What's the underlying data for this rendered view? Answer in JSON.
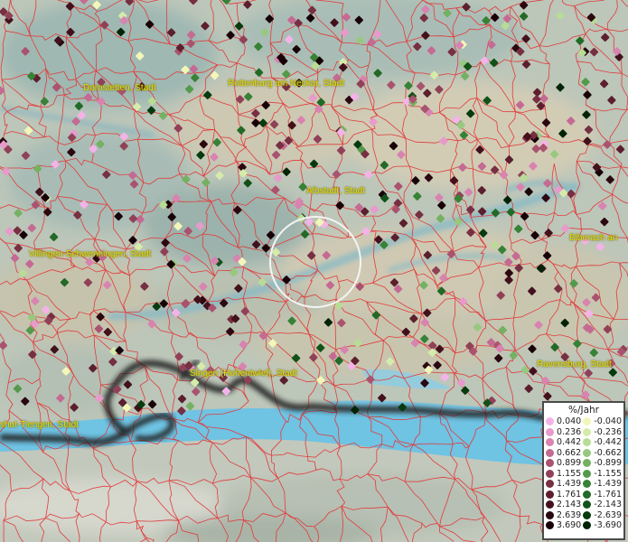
{
  "places": [
    {
      "id": "dornstetten",
      "label": "Dornstetten, Stadt"
    },
    {
      "id": "rottenburg",
      "label": "Rottenburg am Neckar, Stadt"
    },
    {
      "id": "albstadt",
      "label": "Albstadt, Stadt"
    },
    {
      "id": "biberach",
      "label": "Biberach an"
    },
    {
      "id": "villingen",
      "label": "Villingen-Schwenningen, Stadt"
    },
    {
      "id": "singen",
      "label": "Singen (Hohentwiel), Stadt"
    },
    {
      "id": "ravensburg",
      "label": "Ravensburg, Stadt"
    },
    {
      "id": "waldshut",
      "label": "shut-Tiengen, Stadt"
    }
  ],
  "legend": {
    "title": "%/Jahr",
    "positive": [
      {
        "label": "0.040",
        "color": "#f4b3e8"
      },
      {
        "label": "0.236",
        "color": "#e79acb"
      },
      {
        "label": "0.442",
        "color": "#d883b0"
      },
      {
        "label": "0.662",
        "color": "#c46a93"
      },
      {
        "label": "0.899",
        "color": "#a9536f"
      },
      {
        "label": "1.155",
        "color": "#904157"
      },
      {
        "label": "1.439",
        "color": "#772f42"
      },
      {
        "label": "1.761",
        "color": "#5c1f2d"
      },
      {
        "label": "2.143",
        "color": "#42111c"
      },
      {
        "label": "2.639",
        "color": "#2b0710"
      },
      {
        "label": "3.690",
        "color": "#170107"
      }
    ],
    "negative": [
      {
        "label": "-0.040",
        "color": "#f2f7b8"
      },
      {
        "label": "-0.236",
        "color": "#d6ebaa"
      },
      {
        "label": "-0.442",
        "color": "#b8dc96"
      },
      {
        "label": "-0.662",
        "color": "#97c87e"
      },
      {
        "label": "-0.899",
        "color": "#74b162"
      },
      {
        "label": "-1.155",
        "color": "#539a4a"
      },
      {
        "label": "-1.439",
        "color": "#378236"
      },
      {
        "label": "-1.761",
        "color": "#226a26"
      },
      {
        "label": "-2.143",
        "color": "#125219"
      },
      {
        "label": "-2.639",
        "color": "#073a0e"
      },
      {
        "label": "-3.690",
        "color": "#012305"
      }
    ]
  },
  "colors": {
    "boundary": "#e23b3b",
    "lake": "#6fc3e3",
    "border": "#111111",
    "label": "#e8e100"
  }
}
